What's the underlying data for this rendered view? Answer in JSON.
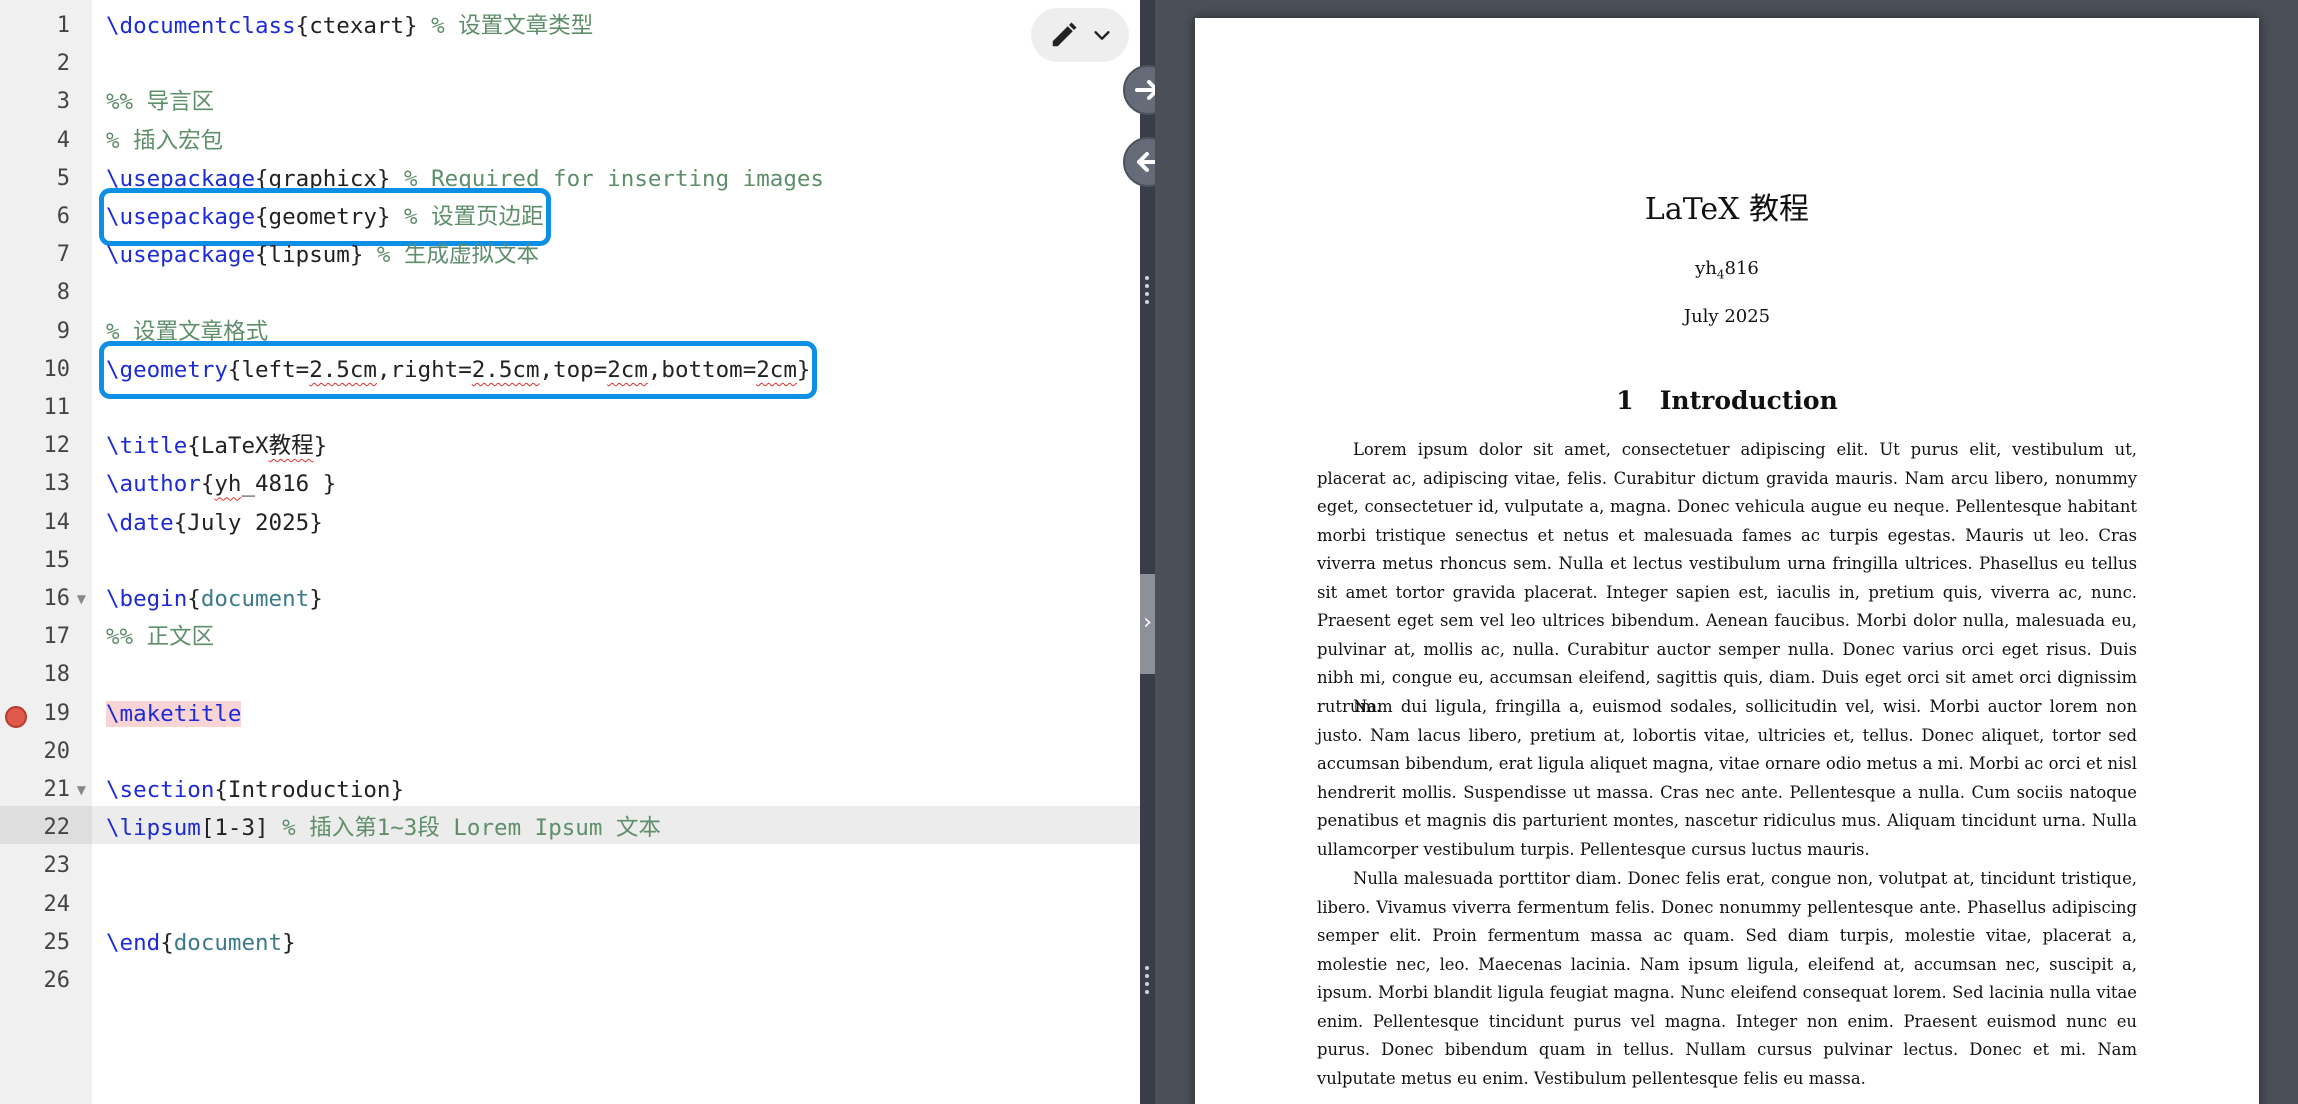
{
  "editor": {
    "lines": [
      {
        "n": "1",
        "tokens": [
          {
            "t": "\\documentclass",
            "c": "cmd"
          },
          {
            "t": "{ctexart}",
            "c": "arg"
          },
          {
            "t": " % 设置文章类型",
            "c": "cmt"
          }
        ]
      },
      {
        "n": "2",
        "tokens": []
      },
      {
        "n": "3",
        "tokens": [
          {
            "t": "%% 导言区",
            "c": "cmt"
          }
        ]
      },
      {
        "n": "4",
        "tokens": [
          {
            "t": "% 插入宏包",
            "c": "cmt"
          }
        ]
      },
      {
        "n": "5",
        "tokens": [
          {
            "t": "\\usepackage",
            "c": "cmd"
          },
          {
            "t": "{graphicx}",
            "c": "arg"
          },
          {
            "t": " % Required for inserting images",
            "c": "cmt"
          }
        ]
      },
      {
        "n": "6",
        "boxed": true,
        "tokens": [
          {
            "t": "\\usepackage",
            "c": "cmd"
          },
          {
            "t": "{geometry}",
            "c": "arg"
          },
          {
            "t": " % 设置页边距",
            "c": "cmt"
          }
        ]
      },
      {
        "n": "7",
        "tokens": [
          {
            "t": "\\usepackage",
            "c": "cmd"
          },
          {
            "t": "{lipsum}",
            "c": "arg"
          },
          {
            "t": " % 生成虚拟文本",
            "c": "cmt"
          }
        ]
      },
      {
        "n": "8",
        "tokens": []
      },
      {
        "n": "9",
        "tokens": [
          {
            "t": "% 设置文章格式",
            "c": "cmt"
          }
        ]
      },
      {
        "n": "10",
        "boxed": true,
        "tokens": [
          {
            "t": "\\geometry",
            "c": "cmd"
          },
          {
            "t": "{left=",
            "c": "arg"
          },
          {
            "t": "2.5cm",
            "c": "arg squig"
          },
          {
            "t": ",right=",
            "c": "arg"
          },
          {
            "t": "2.5cm",
            "c": "arg squig"
          },
          {
            "t": ",top=",
            "c": "arg"
          },
          {
            "t": "2cm",
            "c": "arg squig"
          },
          {
            "t": ",bottom=",
            "c": "arg"
          },
          {
            "t": "2cm",
            "c": "arg squig"
          },
          {
            "t": "}",
            "c": "arg"
          }
        ]
      },
      {
        "n": "11",
        "tokens": []
      },
      {
        "n": "12",
        "tokens": [
          {
            "t": "\\title",
            "c": "cmd"
          },
          {
            "t": "{LaTeX",
            "c": "arg"
          },
          {
            "t": "教程",
            "c": "arg squig"
          },
          {
            "t": "}",
            "c": "arg"
          }
        ]
      },
      {
        "n": "13",
        "tokens": [
          {
            "t": "\\author",
            "c": "cmd"
          },
          {
            "t": "{",
            "c": "arg"
          },
          {
            "t": "yh",
            "c": "arg squig"
          },
          {
            "t": "_4816 }",
            "c": "arg"
          }
        ]
      },
      {
        "n": "14",
        "tokens": [
          {
            "t": "\\date",
            "c": "cmd"
          },
          {
            "t": "{July 2025}",
            "c": "arg"
          }
        ]
      },
      {
        "n": "15",
        "tokens": []
      },
      {
        "n": "16",
        "fold": true,
        "tokens": [
          {
            "t": "\\begin",
            "c": "cmd"
          },
          {
            "t": "{",
            "c": "arg"
          },
          {
            "t": "document",
            "c": "env"
          },
          {
            "t": "}",
            "c": "arg"
          }
        ]
      },
      {
        "n": "17",
        "tokens": [
          {
            "t": "%% 正文区",
            "c": "cmt"
          }
        ]
      },
      {
        "n": "18",
        "tokens": []
      },
      {
        "n": "19",
        "breakpoint": true,
        "tokens": [
          {
            "t": "\\maketitle",
            "c": "cmd hl-red"
          }
        ]
      },
      {
        "n": "20",
        "tokens": []
      },
      {
        "n": "21",
        "fold": true,
        "tokens": [
          {
            "t": "\\section",
            "c": "cmd"
          },
          {
            "t": "{Introduction}",
            "c": "arg"
          }
        ]
      },
      {
        "n": "22",
        "active": true,
        "tokens": [
          {
            "t": "\\lipsum",
            "c": "cmd"
          },
          {
            "t": "[1-3]",
            "c": "arg"
          },
          {
            "t": " % 插入第1~3段 Lorem Ipsum 文本",
            "c": "cmt"
          }
        ]
      },
      {
        "n": "23",
        "tokens": []
      },
      {
        "n": "24",
        "tokens": []
      },
      {
        "n": "25",
        "tokens": [
          {
            "t": "\\end",
            "c": "cmd"
          },
          {
            "t": "{",
            "c": "arg"
          },
          {
            "t": "document",
            "c": "env"
          },
          {
            "t": "}",
            "c": "arg"
          }
        ]
      },
      {
        "n": "26",
        "tokens": []
      }
    ]
  },
  "toolbar": {
    "edit_icon": "pencil-icon",
    "dropdown_icon": "chevron-down-icon"
  },
  "sync": {
    "to_pdf_icon": "arrow-right-icon",
    "to_code_icon": "arrow-left-icon"
  },
  "pdf": {
    "title": "LaTeX 教程",
    "author_prefix": "yh",
    "author_sub": "4",
    "author_suffix": "816",
    "date": "July 2025",
    "section_number": "1",
    "section_title": "Introduction",
    "paragraphs": [
      "Lorem ipsum dolor sit amet, consectetuer adipiscing elit. Ut purus elit, vestibulum ut, placerat ac, adipiscing vitae, felis. Curabitur dictum gravida mauris. Nam arcu libero, nonummy eget, consectetuer id, vulputate a, magna. Donec vehicula augue eu neque. Pellentesque habitant morbi tristique senectus et netus et malesuada fames ac turpis egestas. Mauris ut leo. Cras viverra metus rhoncus sem. Nulla et lectus vestibulum urna fringilla ultrices. Phasellus eu tellus sit amet tortor gravida placerat. Integer sapien est, iaculis in, pretium quis, viverra ac, nunc. Praesent eget sem vel leo ultrices bibendum. Aenean faucibus. Morbi dolor nulla, malesuada eu, pulvinar at, mollis ac, nulla. Curabitur auctor semper nulla. Donec varius orci eget risus. Duis nibh mi, congue eu, accumsan eleifend, sagittis quis, diam. Duis eget orci sit amet orci dignissim rutrum.",
      "Nam dui ligula, fringilla a, euismod sodales, sollicitudin vel, wisi. Morbi auctor lorem non justo. Nam lacus libero, pretium at, lobortis vitae, ultricies et, tellus. Donec aliquet, tortor sed accumsan bibendum, erat ligula aliquet magna, vitae ornare odio metus a mi. Morbi ac orci et nisl hendrerit mollis. Suspendisse ut massa. Cras nec ante. Pellentesque a nulla. Cum sociis natoque penatibus et magnis dis parturient montes, nascetur ridiculus mus. Aliquam tincidunt urna. Nulla ullamcorper vestibulum turpis. Pellentesque cursus luctus mauris.",
      "Nulla malesuada porttitor diam. Donec felis erat, congue non, volutpat at, tincidunt tristique, libero. Vivamus viverra fermentum felis. Donec nonummy pellentesque ante. Phasellus adipiscing semper elit. Proin fermentum massa ac quam. Sed diam turpis, molestie vitae, placerat a, molestie nec, leo. Maecenas lacinia. Nam ipsum ligula, eleifend at, accumsan nec, suscipit a, ipsum. Morbi blandit ligula feugiat magna. Nunc eleifend consequat lorem. Sed lacinia nulla vitae enim. Pellentesque tincidunt purus vel magna. Integer non enim. Praesent euismod nunc eu purus. Donec bibendum quam in tellus. Nullam cursus pulvinar lectus. Donec et mi. Nam vulputate metus eu enim. Vestibulum pellentesque felis eu massa."
    ]
  }
}
